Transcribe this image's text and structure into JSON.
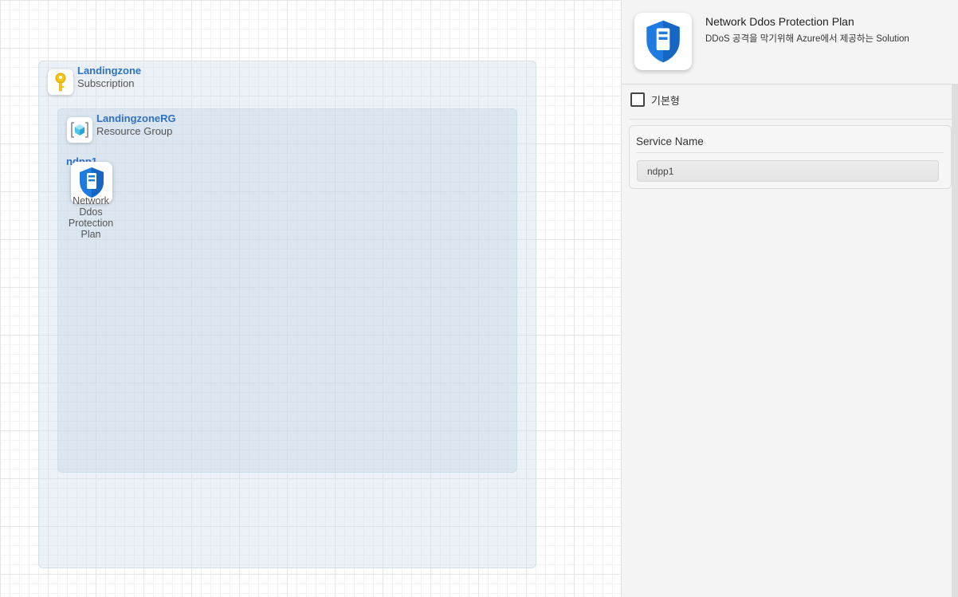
{
  "canvas": {
    "subscription": {
      "title": "Landingzone",
      "subtitle": "Subscription",
      "icon": "key-icon"
    },
    "resource_group": {
      "title": "LandingzoneRG",
      "subtitle": "Resource Group",
      "icon": "resource-group-icon"
    },
    "resource": {
      "name": "ndpp1",
      "caption_lines": [
        "Network",
        "Ddos",
        "Protection",
        "Plan"
      ],
      "icon": "shield-icon"
    }
  },
  "panel": {
    "title": "Network Ddos Protection Plan",
    "description": "DDoS 공격을 막기위해 Azure에서 제공하는 Solution",
    "icon": "shield-icon",
    "checkbox_label": "기본형",
    "checkbox_checked": false,
    "fields": {
      "service_name_label": "Service Name",
      "service_name_value": "ndpp1"
    }
  },
  "colors": {
    "accent_title": "#2f72c4",
    "shield_blue": "#1f7be0"
  }
}
